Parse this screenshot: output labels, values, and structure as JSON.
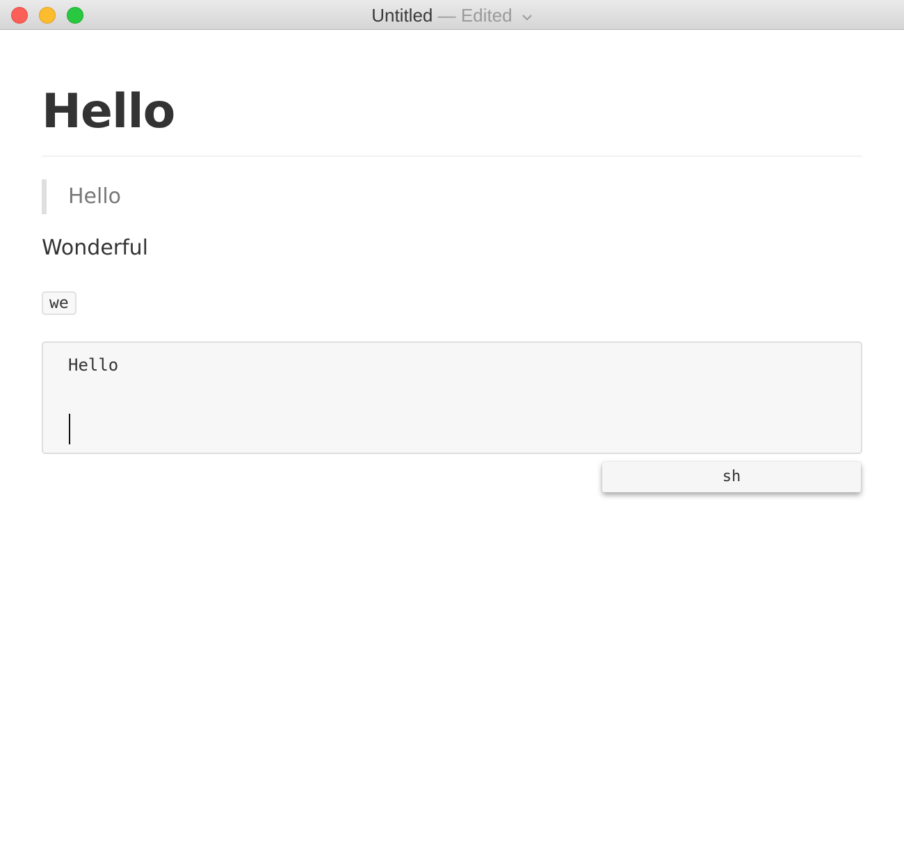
{
  "window": {
    "title": "Untitled",
    "separator": "—",
    "status": "Edited",
    "chevron_icon": "chevron-down-icon",
    "traffic_lights": {
      "close": "#fc5f57",
      "minimize": "#fdbc2e",
      "maximize": "#28c840"
    }
  },
  "document": {
    "heading": "Hello",
    "blockquote": "Hello",
    "paragraph": "Wonderful",
    "inline_code": "we",
    "code_block": {
      "lines": [
        "Hello",
        ""
      ]
    }
  },
  "language_popup": {
    "value": "sh"
  }
}
